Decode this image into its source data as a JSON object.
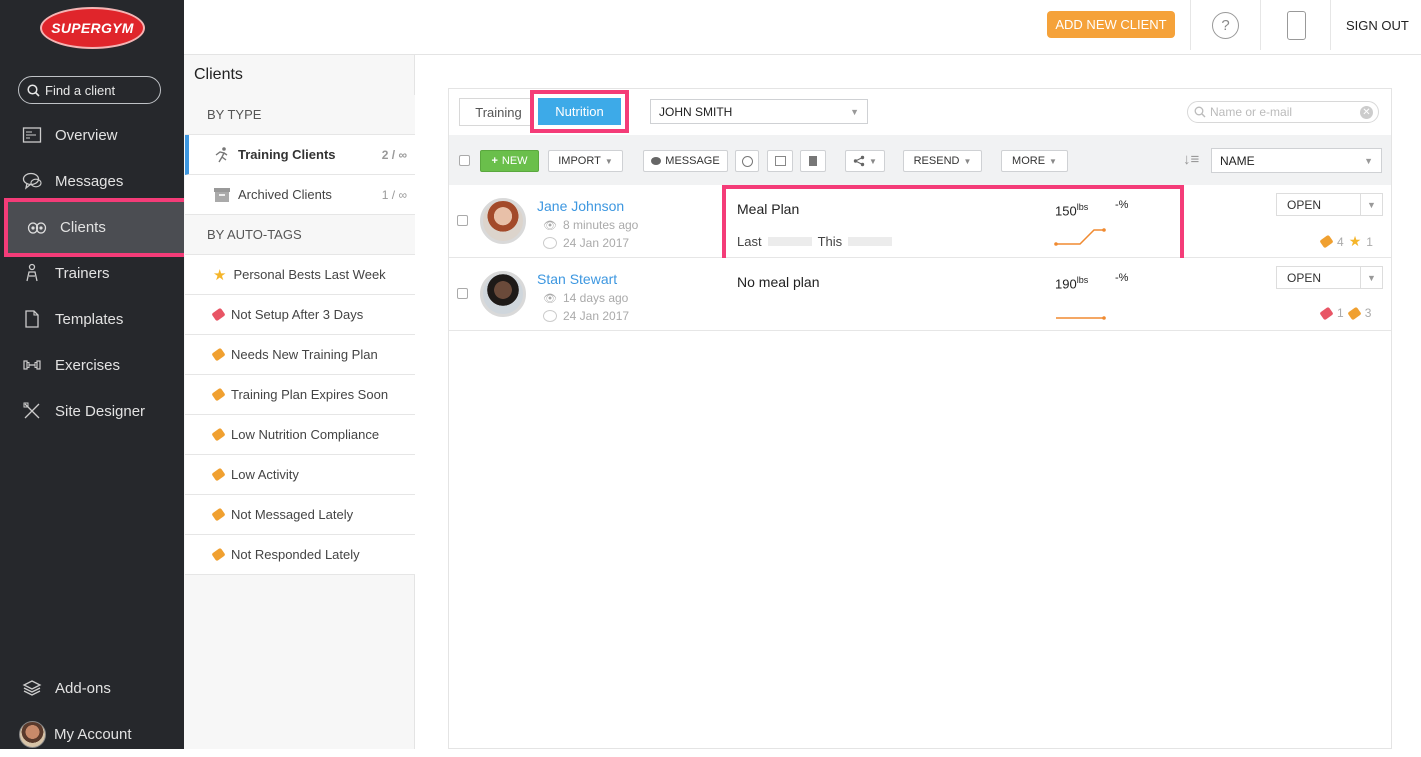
{
  "app": {
    "logo": "SUPERGYM"
  },
  "sidebar": {
    "search_placeholder": "Find a client",
    "items": [
      {
        "label": "Overview"
      },
      {
        "label": "Messages"
      },
      {
        "label": "Clients"
      },
      {
        "label": "Trainers"
      },
      {
        "label": "Templates"
      },
      {
        "label": "Exercises"
      },
      {
        "label": "Site Designer"
      }
    ],
    "bottom": [
      {
        "label": "Add-ons"
      },
      {
        "label": "My Account"
      }
    ]
  },
  "topbar": {
    "add_client": "ADD NEW CLIENT",
    "help": "?",
    "signout": "SIGN OUT"
  },
  "categories": {
    "title": "Clients",
    "by_type": "BY TYPE",
    "types": [
      {
        "label": "Training Clients",
        "count": "2 / ∞"
      },
      {
        "label": "Archived Clients",
        "count": "1 / ∞"
      }
    ],
    "by_tags": "BY AUTO-TAGS",
    "tags": [
      {
        "label": "Personal Bests Last Week",
        "icon": "star-icon",
        "color": "#f5b52a"
      },
      {
        "label": "Not Setup After 3 Days",
        "icon": "tag-icon",
        "color": "#e85565"
      },
      {
        "label": "Needs New Training Plan",
        "icon": "tag-icon",
        "color": "#f0a030"
      },
      {
        "label": "Training Plan Expires Soon",
        "icon": "tag-icon",
        "color": "#f0a030"
      },
      {
        "label": "Low Nutrition Compliance",
        "icon": "tag-icon",
        "color": "#f0a030"
      },
      {
        "label": "Low Activity",
        "icon": "tag-icon",
        "color": "#f0a030"
      },
      {
        "label": "Not Messaged Lately",
        "icon": "tag-icon",
        "color": "#f0a030"
      },
      {
        "label": "Not Responded Lately",
        "icon": "tag-icon",
        "color": "#f0a030"
      }
    ]
  },
  "tabs": {
    "training": "Training",
    "nutrition": "Nutrition"
  },
  "trainer_select": "JOHN SMITH",
  "search": {
    "placeholder": "Name or e-mail"
  },
  "toolbar": {
    "new": "NEW",
    "import": "IMPORT",
    "message": "MESSAGE",
    "resend": "RESEND",
    "more": "MORE",
    "sort": "NAME"
  },
  "clients": [
    {
      "name": "Jane Johnson",
      "seen": "8 minutes ago",
      "date": "24 Jan 2017",
      "plan": "Meal Plan",
      "last_label": "Last",
      "this_label": "This",
      "weight": "150",
      "unit": "lbs",
      "pct": "-%",
      "action": "OPEN",
      "tag_count": "4",
      "star_count": "1"
    },
    {
      "name": "Stan Stewart",
      "seen": "14 days ago",
      "date": "24 Jan 2017",
      "plan": "No meal plan",
      "weight": "190",
      "unit": "lbs",
      "pct": "-%",
      "action": "OPEN",
      "red_tag_count": "1",
      "tag_count": "3"
    }
  ],
  "colors": {
    "accent": "#3d97e0",
    "highlight": "#f43c78",
    "orange": "#f5a23a",
    "sidebar": "#26282c"
  }
}
